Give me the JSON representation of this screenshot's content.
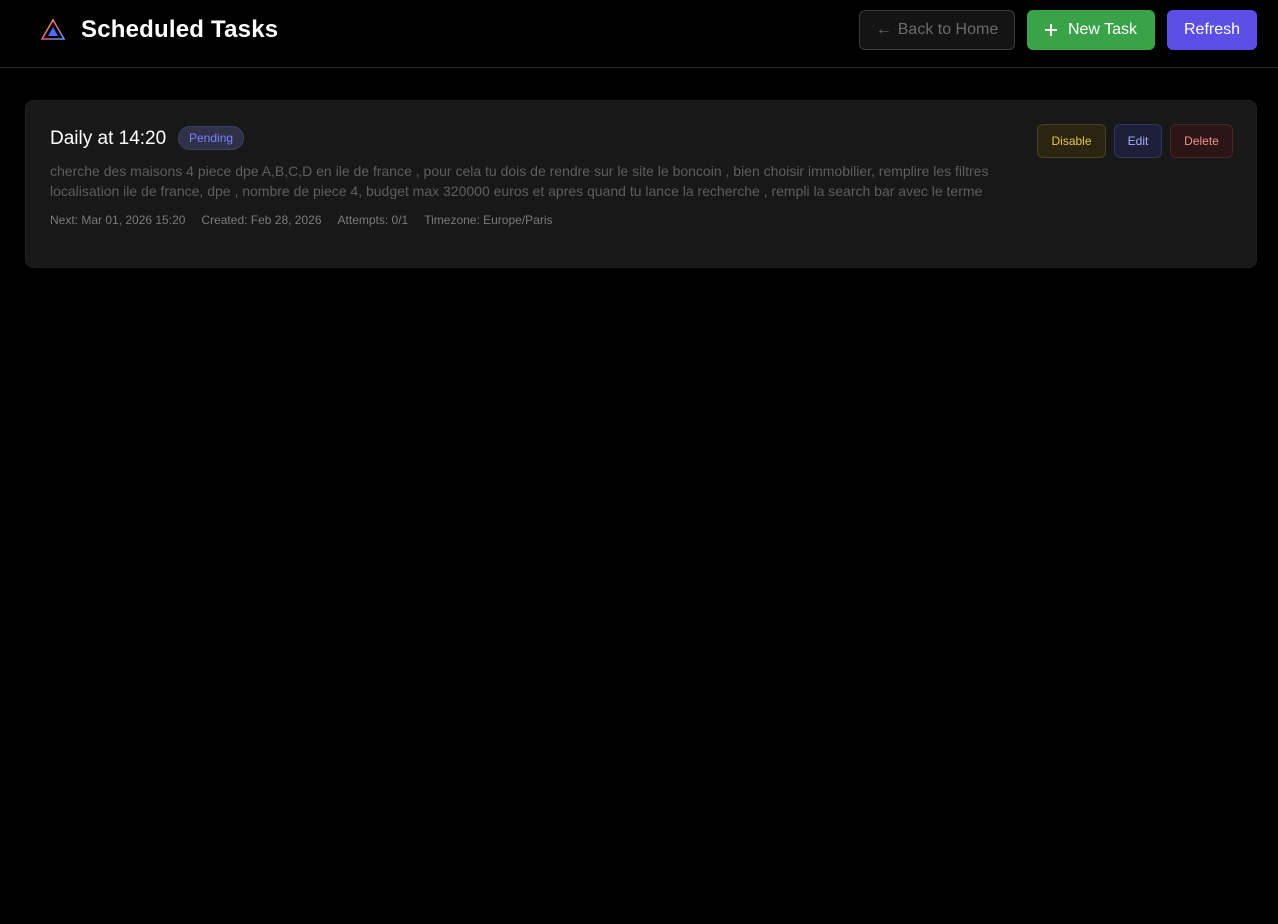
{
  "header": {
    "title": "Scheduled Tasks",
    "logo_icon": "triangle-logo-icon",
    "back_label": "Back to Home",
    "back_icon": "arrow-left-icon",
    "new_task_label": "New Task",
    "new_task_icon": "plus-icon",
    "refresh_label": "Refresh"
  },
  "tasks": [
    {
      "title": "Daily at 14:20",
      "status": "Pending",
      "description": "cherche des maisons 4 piece dpe A,B,C,D en ile de france , pour cela tu dois de rendre sur le site le boncoin , bien choisir immobilier, remplire les filtres localisation ile de france, dpe , nombre de piece 4, budget max 320000 euros et apres quand tu lance la recherche , rempli la search bar avec le terme",
      "next": "Next: Mar 01, 2026 15:20",
      "created": "Created: Feb 28, 2026",
      "attempts": "Attempts: 0/1",
      "timezone": "Timezone: Europe/Paris",
      "actions": {
        "disable": "Disable",
        "edit": "Edit",
        "delete": "Delete"
      }
    }
  ],
  "colors": {
    "background": "#000000",
    "card": "#181818",
    "new_task": "#3aa34a",
    "refresh": "#5b4fe6",
    "pending": "#7c83ff",
    "disable": "#e8c84a",
    "delete": "#ef8f8f"
  }
}
